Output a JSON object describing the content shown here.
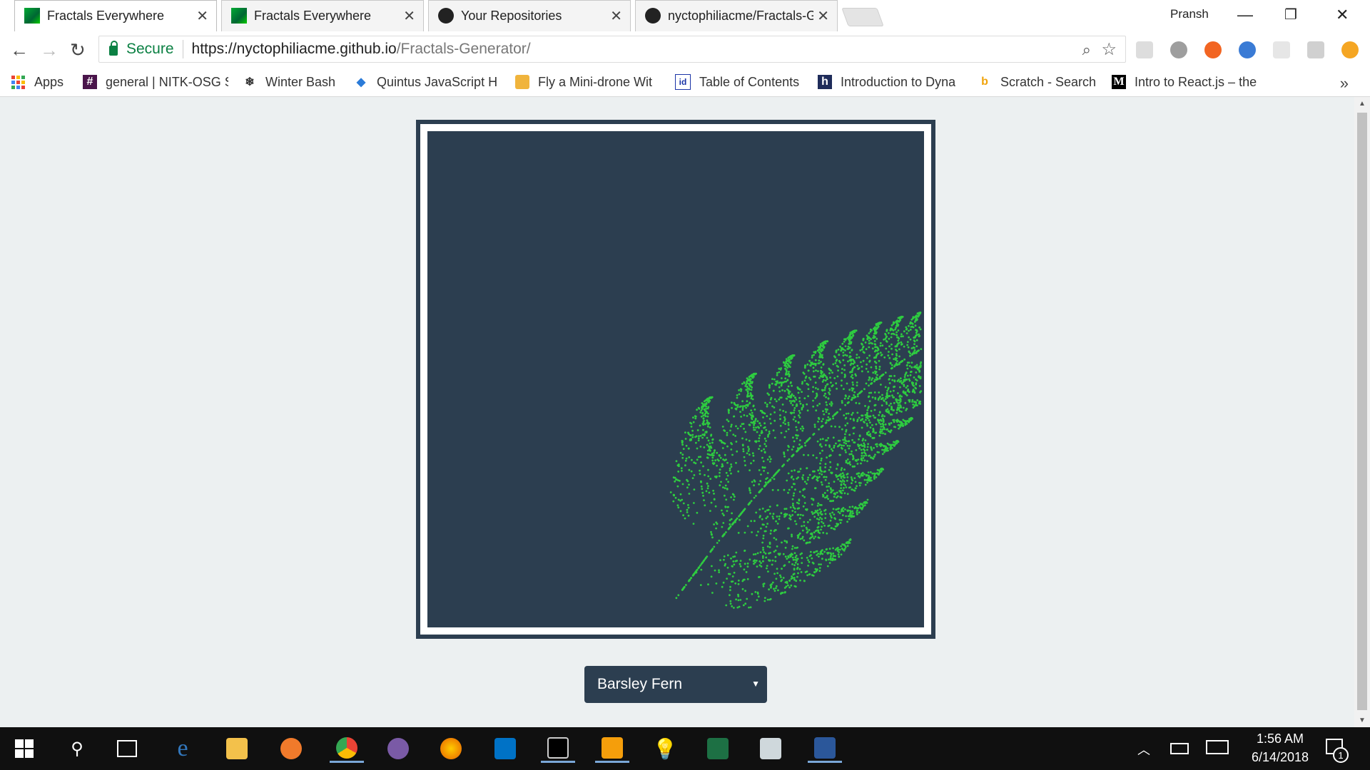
{
  "browser": {
    "tabs": [
      {
        "title": "Fractals Everywhere",
        "active": true,
        "favicon": "fractal-icon"
      },
      {
        "title": "Fractals Everywhere",
        "active": false,
        "favicon": "fractal-icon"
      },
      {
        "title": "Your Repositories",
        "active": false,
        "favicon": "github-icon"
      },
      {
        "title": "nyctophiliacme/Fractals-G",
        "active": false,
        "favicon": "github-icon"
      }
    ],
    "profile_name": "Pransh",
    "address": {
      "secure_label": "Secure",
      "url_domain": "https://nyctophiliacme.github.io",
      "url_path": "/Fractals-Generator/"
    },
    "bookmarks": [
      {
        "label": "Apps",
        "icon": "apps-grid-icon"
      },
      {
        "label": "general | NITK-OSG S",
        "icon": "slack-hash-icon"
      },
      {
        "label": "Winter Bash",
        "icon": "snowflake-icon"
      },
      {
        "label": "Quintus JavaScript H",
        "icon": "quintus-icon"
      },
      {
        "label": "Fly a Mini-drone Wit",
        "icon": "drone-icon"
      },
      {
        "label": "Table of Contents",
        "icon": "id-icon"
      },
      {
        "label": "Introduction to Dyna",
        "icon": "hackerearth-icon"
      },
      {
        "label": "Scratch - Search",
        "icon": "bing-icon"
      },
      {
        "label": "Intro to React.js – the",
        "icon": "medium-icon"
      }
    ]
  },
  "page": {
    "fractal": {
      "name": "Barsley Fern",
      "dot_color": "#2ecc40",
      "background_color": "#2c3e50"
    },
    "fractal_select": {
      "selected": "Barsley Fern"
    }
  },
  "taskbar": {
    "clock_time": "1:56 AM",
    "clock_date": "6/14/2018",
    "notification_count": "1"
  }
}
